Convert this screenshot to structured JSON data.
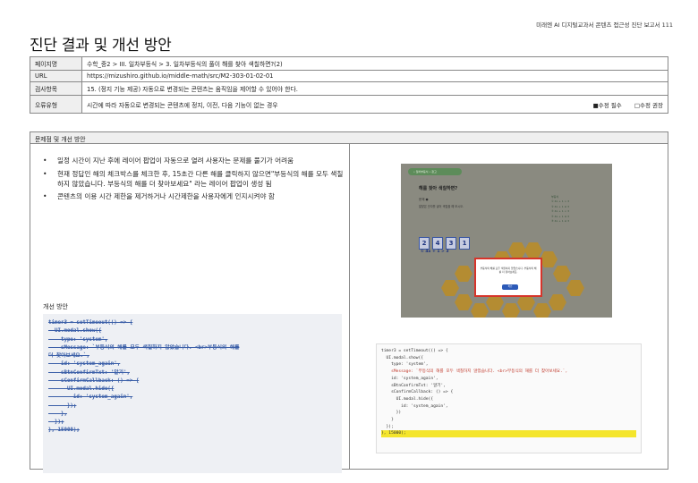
{
  "header": {
    "report_title": "미래엔 AI 디지털교과서 콘텐츠 접근성 진단 보고서 111"
  },
  "page_title": "진단 결과 및 개선 방안",
  "info": {
    "rows": [
      {
        "key": "페이지명",
        "value": "수학_중2 > III. 일차부등식 > 3. 일차부등식의 풀이 해를 찾아 색칠하면?(2)"
      },
      {
        "key": "URL",
        "value": "https://mizushiro.github.io/middle-math/src/M2-303-01-02-01"
      },
      {
        "key": "검사항목",
        "value": "15. (정지 기능 제공) 자동으로 변경되는 콘텐츠는 움직임을 제어할 수 있어야 한다."
      },
      {
        "key": "오류유형",
        "value": "시간에 따라 자동으로 변경되는 콘텐츠에 정지, 이전, 다음 기능이 없는 경우"
      }
    ],
    "check_required": "■수정 필수",
    "check_recommended": "□수정 권장"
  },
  "issue": {
    "heading": "문제점 및 개선 방안",
    "problems": [
      "일정 시간이 지난 후에 레이어 팝업이 자동으로 열려 사용자는 문제를 풀기가 어려움",
      "현재 정답인 해의 체크박스를 체크한 후, 15초간 다른 해를 클릭하지 않으면\"부등식의 해를 모두 색칠하지 않았습니다. 부등식의 해를 더 찾아보세요\" 라는 레이어 팝업이 생성 됨",
      "콘텐츠의 이용 시간 제한을 제거하거나 시간제한을 사용자에게 인지시켜야 함"
    ],
    "improve_label": "개선 방안",
    "code_left": [
      "timer3 = setTimeout(() => {",
      "  UI.modal.show({",
      "    type: 'system',",
      "    sMessage: `부등식의 해를 모두 색칠하지 않았습니다. <br>부등식의 해를",
      "더 찾아보세요.`,",
      "    id: 'system_again',",
      "    sBtnConfirmTxt: '알기',",
      "    sConfirmCallback: () => {",
      "      UI.modal.hide({",
      "        id: 'system_again',",
      "      });",
      "    },",
      "  });",
      "}, 15000);"
    ]
  },
  "screenshot": {
    "pill_label": "• 일차부등식 • 참고",
    "question_title": "해를 찾아 색칠하면?",
    "question_sub": "문제 ●",
    "question_hint": "알맞은 숫자를 넣어 색칠을 해 보시오.",
    "numbers": [
      "2",
      "4",
      "3",
      "1"
    ],
    "equation": "① 4x + 1 > 3",
    "choices": [
      "부등식",
      "① 4x + 1 > 3",
      "② 4x + 1 ≥ 3",
      "③ 4x + 1 < 3",
      "④ 4x + 1 ≤ 3",
      "⑤ 4x + 1 ≥ 3"
    ],
    "modal_text": "부등식의 해를 모두 색칠하지 않았습니다. 부등식의 해를 더 찾아보세요.",
    "modal_button": "확인",
    "code_lines": [
      "timer3 = setTimeout(() => {",
      "  UI.modal.show({",
      "    type: 'system',",
      "    sMessage: `부등식의 해를 모두 색칠하지 않았습니다. <br>부등식의 해를 더 찾아보세요.`,",
      "    id: 'system_again',",
      "    sBtnConfirmTxt: '알기',",
      "    sConfirmCallback: () => {",
      "      UI.modal.hide({",
      "        id: 'system_again',",
      "      })",
      "    }",
      "  });",
      "}, 15000);"
    ]
  }
}
